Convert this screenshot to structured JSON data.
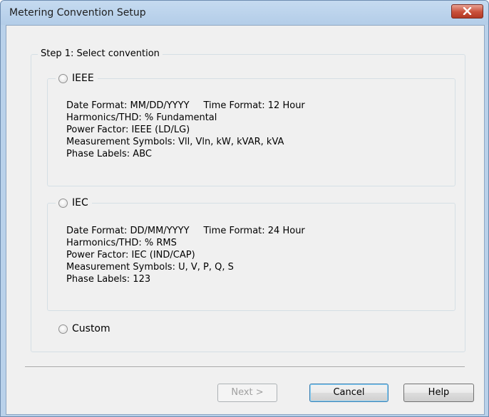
{
  "window": {
    "title": "Metering Convention Setup",
    "close_icon": "close-icon",
    "accent": "#c9503a"
  },
  "step": {
    "label": "Step 1: Select convention"
  },
  "options": {
    "ieee": {
      "label": "IEEE",
      "selected": false,
      "date_format": "Date Format: MM/DD/YYYY",
      "time_format": "Time Format: 12 Hour",
      "harmonics": "Harmonics/THD: % Fundamental",
      "power_factor": "Power Factor: IEEE (LD/LG)",
      "symbols": "Measurement Symbols: Vll, Vln, kW, kVAR, kVA",
      "phase": "Phase Labels: ABC"
    },
    "iec": {
      "label": "IEC",
      "selected": false,
      "date_format": "Date Format: DD/MM/YYYY",
      "time_format": "Time Format: 24 Hour",
      "harmonics": "Harmonics/THD: % RMS",
      "power_factor": "Power Factor: IEC (IND/CAP)",
      "symbols": "Measurement Symbols: U, V, P, Q, S",
      "phase": "Phase Labels: 123"
    },
    "custom": {
      "label": "Custom",
      "selected": false
    }
  },
  "buttons": {
    "next": "Next >",
    "cancel": "Cancel",
    "help": "Help"
  }
}
